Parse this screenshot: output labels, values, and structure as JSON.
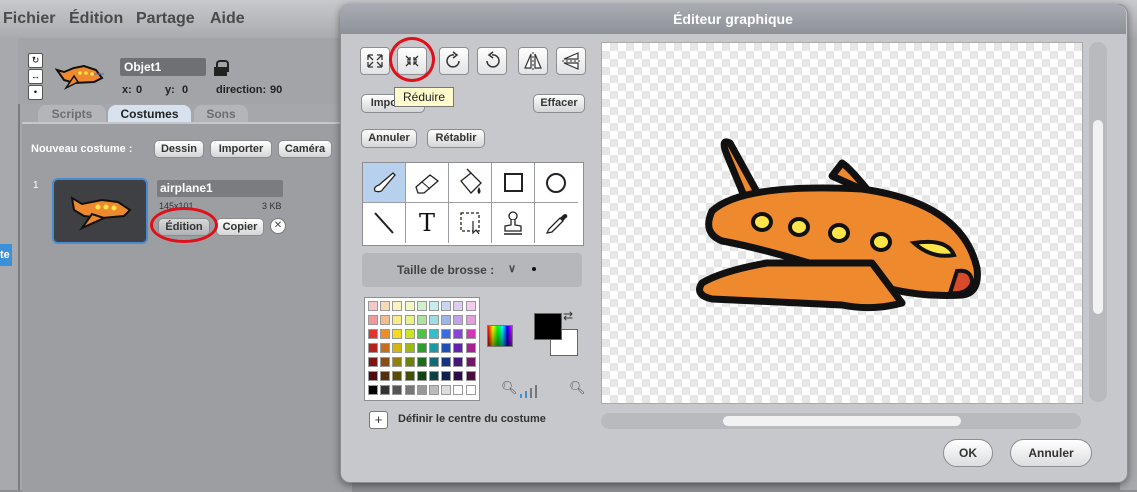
{
  "menu": {
    "items": [
      "Fichier",
      "Édition",
      "Partage",
      "Aide"
    ]
  },
  "sprite": {
    "name": "Objet1",
    "x_label": "x:",
    "x_value": "0",
    "y_label": "y:",
    "y_value": "0",
    "direction_label": "direction:",
    "direction_value": "90"
  },
  "tabs": {
    "scripts": "Scripts",
    "costumes": "Costumes",
    "sounds": "Sons"
  },
  "costumes": {
    "new_label": "Nouveau costume :",
    "draw_button": "Dessin",
    "import_button": "Importer",
    "camera_button": "Caméra",
    "item": {
      "index": "1",
      "name": "airplane1",
      "dimensions": "145x101",
      "size": "3 KB",
      "edit_button": "Édition",
      "copy_button": "Copier"
    }
  },
  "left_edge": {
    "label": "te"
  },
  "editor": {
    "title": "Éditeur graphique",
    "tooltip": "Réduire",
    "import_button": "Importer",
    "clear_button": "Effacer",
    "undo_button": "Annuler",
    "redo_button": "Rétablir",
    "brush_size_label": "Taille de brosse :",
    "set_center_label": "Définir le centre du costume",
    "ok_button": "OK",
    "cancel_button": "Annuler",
    "text_tool_glyph": "T",
    "primary_color": "#000000",
    "secondary_color": "#ffffff"
  },
  "palette": {
    "rows": [
      [
        "#f6c7c9",
        "#f7d9b9",
        "#fbf2c0",
        "#f4f8c2",
        "#d3f0c8",
        "#c9ecef",
        "#c8d6f2",
        "#dccdf1",
        "#f1ccec"
      ],
      [
        "#f09a9b",
        "#f2bd8c",
        "#f8e98a",
        "#e9f289",
        "#aee2a0",
        "#9fdde3",
        "#9db6e8",
        "#bea3e7",
        "#e5a0dc"
      ],
      [
        "#e33434",
        "#ee8c2a",
        "#f7d920",
        "#c9e523",
        "#4fc444",
        "#35bfca",
        "#3a6ede",
        "#8744d6",
        "#d236b9"
      ],
      [
        "#b82020",
        "#c46e1e",
        "#d4b612",
        "#9cb816",
        "#2f9c2c",
        "#1e98a3",
        "#1f4fb5",
        "#6224ad",
        "#a6218f"
      ],
      [
        "#7c1515",
        "#8a4d13",
        "#93800b",
        "#6c800e",
        "#1e6b1d",
        "#146a72",
        "#14357e",
        "#431878",
        "#731664"
      ],
      [
        "#4a0c0c",
        "#53300b",
        "#5a4e06",
        "#414e08",
        "#124212",
        "#0c4146",
        "#0c204d",
        "#290e49",
        "#460d3d"
      ],
      [
        "#000000",
        "#333333",
        "#555555",
        "#777777",
        "#999999",
        "#bbbbbb",
        "#dddddd",
        "#ffffff",
        "#ffffff"
      ]
    ]
  }
}
